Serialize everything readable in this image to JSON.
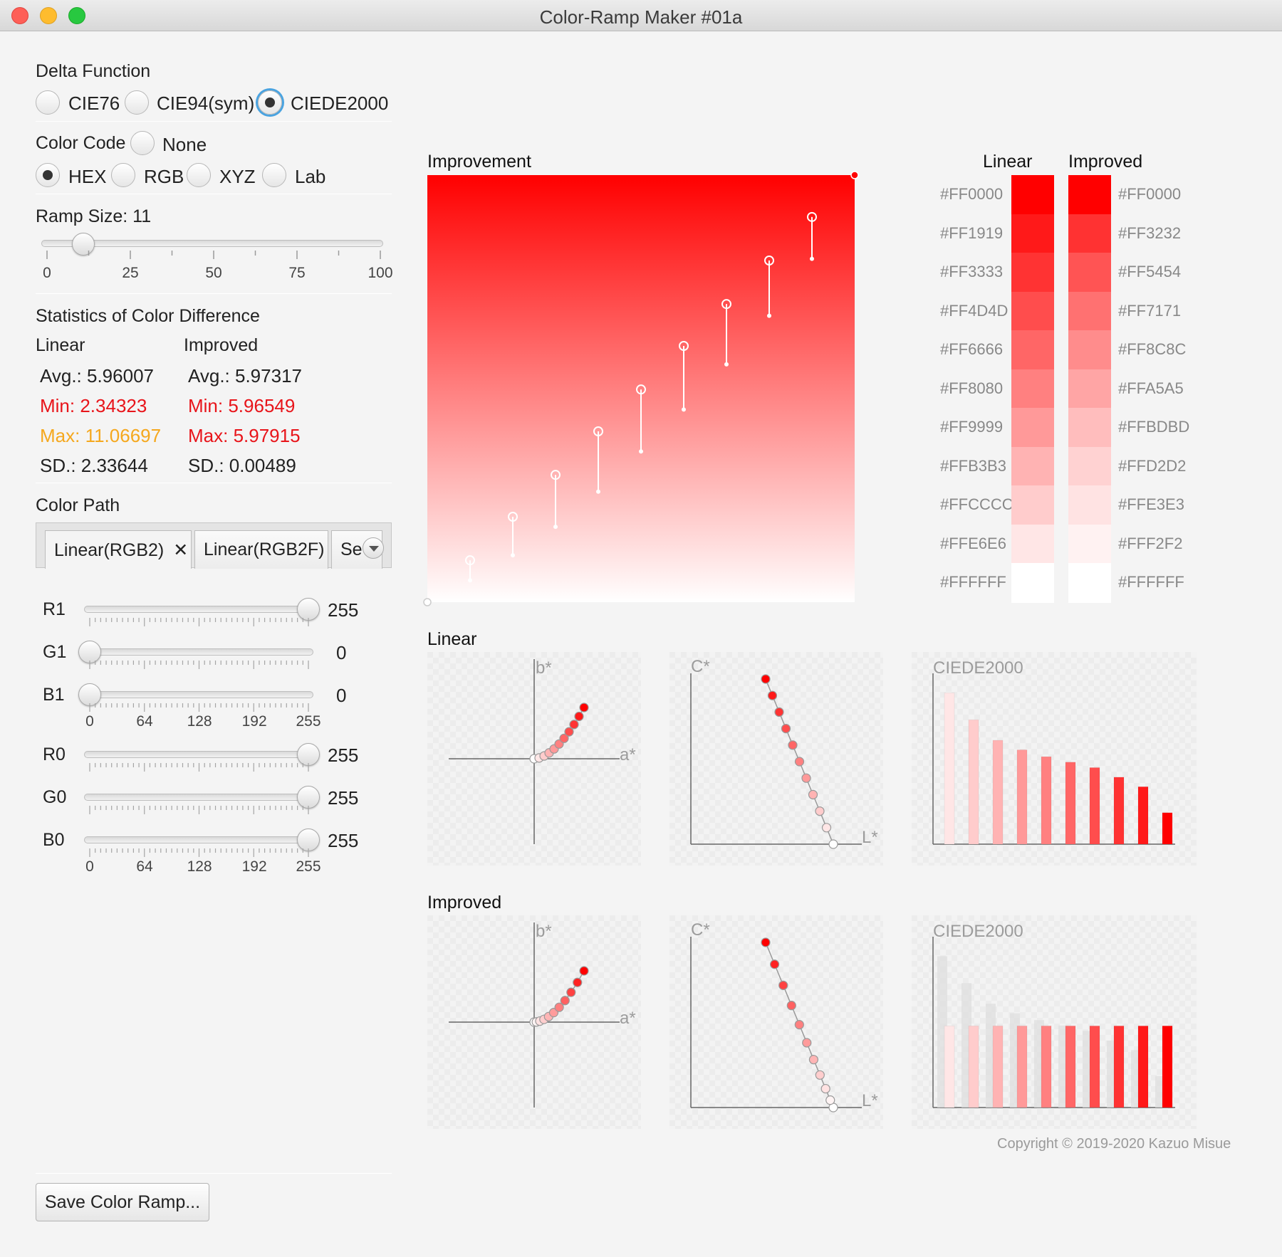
{
  "window": {
    "title": "Color-Ramp Maker #01a"
  },
  "delta_function": {
    "label": "Delta Function",
    "options": [
      {
        "label": "CIE76",
        "selected": false
      },
      {
        "label": "CIE94(sym)",
        "selected": false
      },
      {
        "label": "CIEDE2000",
        "selected": true
      }
    ]
  },
  "color_code": {
    "label": "Color Code",
    "options": [
      {
        "label": "None",
        "selected": false
      },
      {
        "label": "HEX",
        "selected": true
      },
      {
        "label": "RGB",
        "selected": false
      },
      {
        "label": "XYZ",
        "selected": false
      },
      {
        "label": "Lab",
        "selected": false
      }
    ]
  },
  "ramp_size": {
    "label": "Ramp Size: 11",
    "value": 11,
    "min": 0,
    "max": 100,
    "tick_labels": [
      "0",
      "25",
      "50",
      "75",
      "100"
    ]
  },
  "statistics": {
    "label": "Statistics of Color Difference",
    "linear": {
      "header": "Linear",
      "avg": "Avg.: 5.96007",
      "min": "Min: 2.34323",
      "max": "Max: 11.06697",
      "sd": "SD.: 2.33644"
    },
    "improved": {
      "header": "Improved",
      "avg": "Avg.: 5.97317",
      "min": "Min: 5.96549",
      "max": "Max: 5.97915",
      "sd": "SD.: 0.00489"
    }
  },
  "color_path": {
    "label": "Color Path",
    "tabs": [
      {
        "label": "Linear(RGB2)",
        "close": "✕"
      },
      {
        "label": "Linear(RGB2F)"
      },
      {
        "label": "Se"
      }
    ]
  },
  "sliders_group1": {
    "items": [
      {
        "label": "R1",
        "value": 255,
        "value_text": "255"
      },
      {
        "label": "G1",
        "value": 0,
        "value_text": "0"
      },
      {
        "label": "B1",
        "value": 0,
        "value_text": "0"
      }
    ],
    "tick_labels": [
      "0",
      "64",
      "128",
      "192",
      "255"
    ]
  },
  "sliders_group2": {
    "items": [
      {
        "label": "R0",
        "value": 255,
        "value_text": "255"
      },
      {
        "label": "G0",
        "value": 255,
        "value_text": "255"
      },
      {
        "label": "B0",
        "value": 255,
        "value_text": "255"
      }
    ],
    "tick_labels": [
      "0",
      "64",
      "128",
      "192",
      "255"
    ]
  },
  "save_button": "Save Color Ramp...",
  "improvement": {
    "title": "Improvement"
  },
  "ramp_table": {
    "linear_header": "Linear",
    "improved_header": "Improved",
    "linear": [
      "#FF0000",
      "#FF1919",
      "#FF3333",
      "#FF4D4D",
      "#FF6666",
      "#FF8080",
      "#FF9999",
      "#FFB3B3",
      "#FFCCCC",
      "#FFE6E6",
      "#FFFFFF"
    ],
    "improved": [
      "#FF0000",
      "#FF3232",
      "#FF5454",
      "#FF7171",
      "#FF8C8C",
      "#FFA5A5",
      "#FFBDBD",
      "#FFD2D2",
      "#FFE3E3",
      "#FFF2F2",
      "#FFFFFF"
    ]
  },
  "linear_section": {
    "title": "Linear"
  },
  "improved_section": {
    "title": "Improved"
  },
  "plot_labels": {
    "b_star": "b*",
    "a_star": "a*",
    "c_star": "C*",
    "l_star": "L*",
    "ciede": "CIEDE2000"
  },
  "chart_data": [
    {
      "type": "bar",
      "title": "CIEDE2000",
      "series": [
        {
          "name": "Linear",
          "values": [
            11.07,
            9.1,
            7.6,
            6.9,
            6.4,
            6.0,
            5.6,
            4.9,
            4.2,
            2.3
          ]
        }
      ]
    },
    {
      "type": "bar",
      "title": "CIEDE2000",
      "series": [
        {
          "name": "Improved",
          "values": [
            5.97,
            5.97,
            5.97,
            5.97,
            5.97,
            5.97,
            5.97,
            5.97,
            5.97,
            5.97
          ]
        }
      ]
    }
  ],
  "copyright": "Copyright © 2019-2020 Kazuo Misue"
}
